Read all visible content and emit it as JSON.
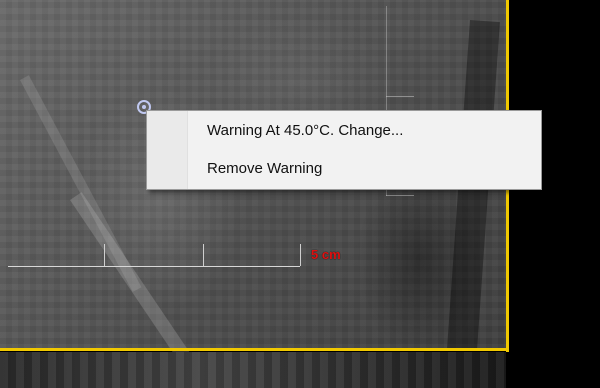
{
  "context_menu": {
    "items": [
      {
        "label": "Warning At 45.0°C. Change..."
      },
      {
        "label": "Remove Warning"
      }
    ]
  },
  "scale_bar": {
    "label": "5 cm",
    "color": "#e01010"
  },
  "viewport": {
    "border_color": "#f0c800"
  },
  "icons": {
    "probe_marker": "target-marker-icon"
  }
}
